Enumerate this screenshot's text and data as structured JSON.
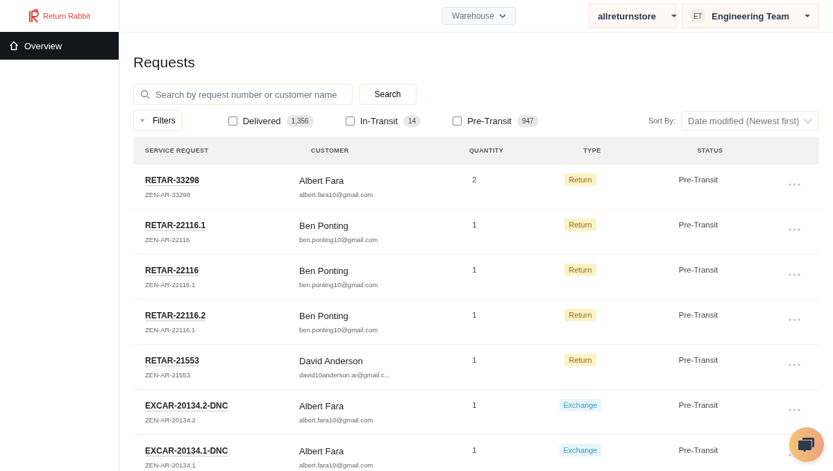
{
  "brand": {
    "name": "Return Rabbit"
  },
  "sidebar": {
    "items": [
      {
        "label": "Overview",
        "selected": true
      }
    ]
  },
  "header": {
    "warehouse": "Warehouse",
    "store": "allreturnstore",
    "team_initials": "ET",
    "team": "Engineering Team"
  },
  "page_title": "Requests",
  "search": {
    "placeholder": "Search by request number or customer name",
    "button": "Search"
  },
  "filters": {
    "label": "Filters",
    "options": [
      {
        "label": "Delivered",
        "count": "1,356",
        "checked": false
      },
      {
        "label": "In-Transit",
        "count": "14",
        "checked": false
      },
      {
        "label": "Pre-Transit",
        "count": "947",
        "checked": false
      }
    ]
  },
  "sort": {
    "label": "Sort By:",
    "value": "Date modified (Newest first)"
  },
  "table": {
    "columns": [
      "SERVICE REQUEST",
      "CUSTOMER",
      "QUANTITY",
      "TYPE",
      "STATUS"
    ],
    "rows": [
      {
        "request": "RETAR-33298",
        "ref": "ZEN-AR-33298",
        "customer": "Albert Fara",
        "email": "albert.fara10@gmail.com",
        "quantity": "2",
        "kind": "return",
        "type": "Return",
        "status": "Pre-Transit"
      },
      {
        "request": "RETAR-22116.1",
        "ref": "ZEN-AR-22116",
        "customer": "Ben Ponting",
        "email": "ben.ponting10@gmail.com",
        "quantity": "1",
        "kind": "return",
        "type": "Return",
        "status": "Pre-Transit"
      },
      {
        "request": "RETAR-22116",
        "ref": "ZEN-AR-22116.1",
        "customer": "Ben Ponting",
        "email": "ben.ponting10@gmail.com",
        "quantity": "1",
        "kind": "return",
        "type": "Return",
        "status": "Pre-Transit"
      },
      {
        "request": "RETAR-22116.2",
        "ref": "ZEN-AR-22116.1",
        "customer": "Ben Ponting",
        "email": "ben.ponting10@gmail.com",
        "quantity": "1",
        "kind": "return",
        "type": "Return",
        "status": "Pre-Transit"
      },
      {
        "request": "RETAR-21553",
        "ref": "ZEN-AR-21553",
        "customer": "David Anderson",
        "email": "david10anderson.ai@gmail.c...",
        "quantity": "1",
        "kind": "return",
        "type": "Return",
        "status": "Pre-Transit"
      },
      {
        "request": "EXCAR-20134.2-DNC",
        "ref": "ZEN-AR-20134.2",
        "customer": "Albert Fara",
        "email": "albert.fara10@gmail.com",
        "quantity": "1",
        "kind": "exchange",
        "type": "Exchange",
        "status": "Pre-Transit"
      },
      {
        "request": "EXCAR-20134.1-DNC",
        "ref": "ZEN-AR-20134.1",
        "customer": "Albert Fara",
        "email": "albert.fara10@gmail.com",
        "quantity": "1",
        "kind": "exchange",
        "type": "Exchange",
        "status": "Pre-Transit"
      }
    ]
  }
}
